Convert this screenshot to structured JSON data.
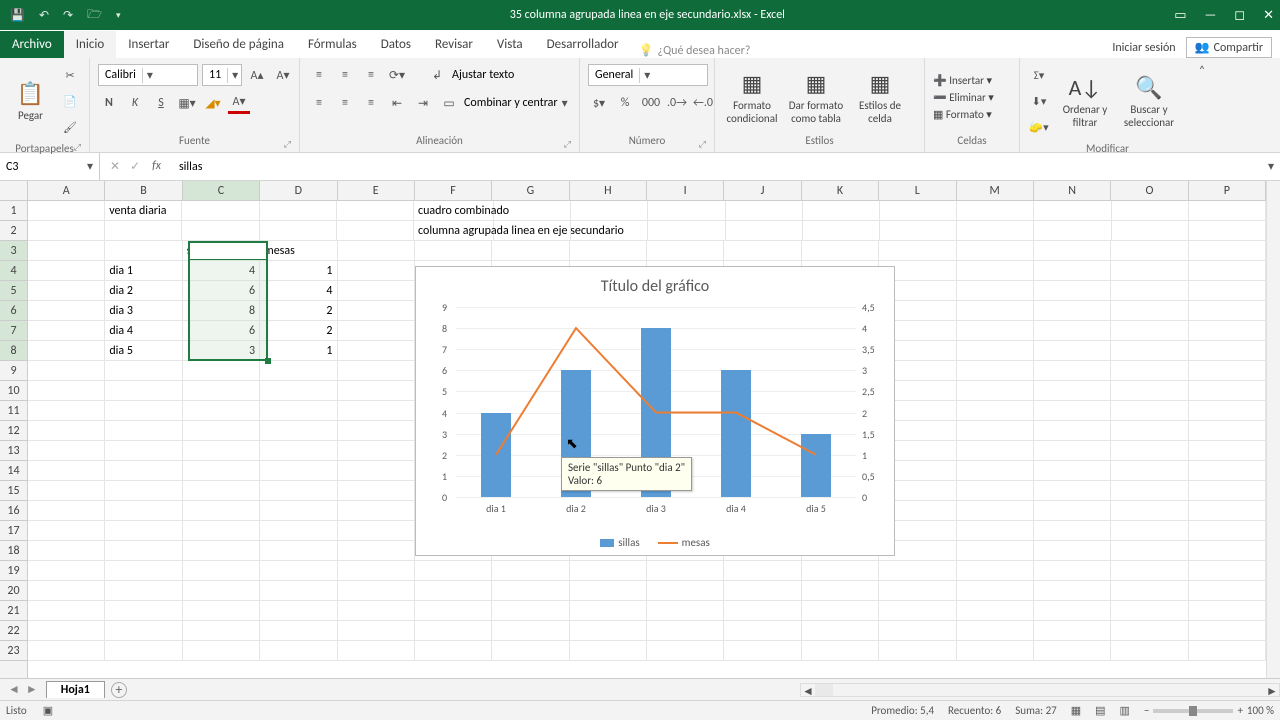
{
  "window": {
    "title": "35 columna agrupada linea en eje secundario.xlsx - Excel",
    "signin": "Iniciar sesión",
    "share": "Compartir"
  },
  "tabs": {
    "file": "Archivo",
    "items": [
      "Inicio",
      "Insertar",
      "Diseño de página",
      "Fórmulas",
      "Datos",
      "Revisar",
      "Vista",
      "Desarrollador"
    ],
    "active": "Inicio",
    "tell": "¿Qué desea hacer?"
  },
  "ribbon": {
    "clipboard": {
      "paste": "Pegar",
      "label": "Portapapeles"
    },
    "font": {
      "name": "Calibri",
      "size": "11",
      "label": "Fuente"
    },
    "align": {
      "wrap": "Ajustar texto",
      "merge": "Combinar y centrar",
      "label": "Alineación"
    },
    "number": {
      "format": "General",
      "label": "Número"
    },
    "styles": {
      "cond": "Formato condicional",
      "table": "Dar formato como tabla",
      "cell": "Estilos de celda",
      "label": "Estilos"
    },
    "cells": {
      "insert": "Insertar",
      "delete": "Eliminar",
      "format": "Formato",
      "label": "Celdas"
    },
    "editing": {
      "sort": "Ordenar y filtrar",
      "find": "Buscar y seleccionar",
      "label": "Modificar"
    }
  },
  "namebox": "C3",
  "formula": "sillas",
  "columns": [
    "A",
    "B",
    "C",
    "D",
    "E",
    "F",
    "G",
    "H",
    "I",
    "J",
    "K",
    "L",
    "M",
    "N",
    "O",
    "P"
  ],
  "rows": 23,
  "data": {
    "B1": "venta diaria",
    "F1": "cuadro combinado",
    "F2": "columna agrupada linea en eje secundario",
    "C3": "sillas",
    "D3": "mesas",
    "B4": "dia 1",
    "C4": "4",
    "D4": "1",
    "B5": "dia 2",
    "C5": "6",
    "D5": "4",
    "B6": "dia 3",
    "C6": "8",
    "D6": "2",
    "B7": "dia 4",
    "C7": "6",
    "D7": "2",
    "B8": "dia 5",
    "C8": "3",
    "D8": "1"
  },
  "chart_data": {
    "type": "combo",
    "title": "Título del gráfico",
    "categories": [
      "dia 1",
      "dia 2",
      "dia 3",
      "dia 4",
      "dia 5"
    ],
    "series": [
      {
        "name": "sillas",
        "type": "bar",
        "axis": "primary",
        "values": [
          4,
          6,
          8,
          6,
          3
        ],
        "color": "#5b9bd5"
      },
      {
        "name": "mesas",
        "type": "line",
        "axis": "secondary",
        "values": [
          1,
          4,
          2,
          2,
          1
        ],
        "color": "#ed7d31"
      }
    ],
    "primary_axis": {
      "ticks": [
        0,
        1,
        2,
        3,
        4,
        5,
        6,
        7,
        8,
        9
      ],
      "max": 9
    },
    "secondary_axis": {
      "ticks": [
        "0",
        "0,5",
        "1",
        "1,5",
        "2",
        "2,5",
        "3",
        "3,5",
        "4",
        "4,5"
      ],
      "max": 4.5
    },
    "tooltip": {
      "line1": "Serie \"sillas\" Punto \"dia 2\"",
      "line2": "Valor: 6"
    }
  },
  "sheet": {
    "name": "Hoja1"
  },
  "status": {
    "ready": "Listo",
    "avg": "Promedio: 5,4",
    "count": "Recuento: 6",
    "sum": "Suma: 27",
    "zoom": "100 %"
  }
}
